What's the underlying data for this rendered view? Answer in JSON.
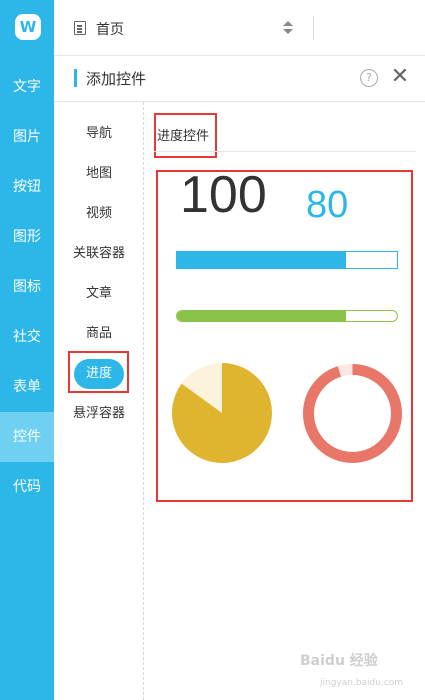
{
  "app": {
    "logo_letter": "W",
    "accent_color": "#2db7e8",
    "highlight_color": "#e53935"
  },
  "sidebar": {
    "items": [
      {
        "label": "文字"
      },
      {
        "label": "图片"
      },
      {
        "label": "按钮"
      },
      {
        "label": "图形"
      },
      {
        "label": "图标"
      },
      {
        "label": "社交"
      },
      {
        "label": "表单"
      },
      {
        "label": "控件",
        "active": true
      },
      {
        "label": "代码"
      }
    ]
  },
  "topbar": {
    "page_label": "首页"
  },
  "panel": {
    "title": "添加控件",
    "help": "?",
    "close": "✕"
  },
  "categories": {
    "items": [
      {
        "label": "导航"
      },
      {
        "label": "地图"
      },
      {
        "label": "视频"
      },
      {
        "label": "关联容器"
      },
      {
        "label": "文章"
      },
      {
        "label": "商品"
      },
      {
        "label": "进度",
        "active": true
      },
      {
        "label": "悬浮容器"
      }
    ]
  },
  "content": {
    "section_title": "进度控件",
    "number_large": "100",
    "number_medium": "80",
    "bar_blue": {
      "progress": 0.77,
      "color": "#2db7e8"
    },
    "bar_green": {
      "progress": 0.77,
      "color": "#8bc34a"
    },
    "pie": {
      "progress": 0.85,
      "color": "#dfb530",
      "remainder_color": "#fbf3dc"
    },
    "ring": {
      "progress": 0.95,
      "color": "#e8776a",
      "remainder_color": "#fbe7e4"
    }
  },
  "watermark": {
    "text": "Baidu 经验",
    "sub": "jingyan.baidu.com"
  }
}
